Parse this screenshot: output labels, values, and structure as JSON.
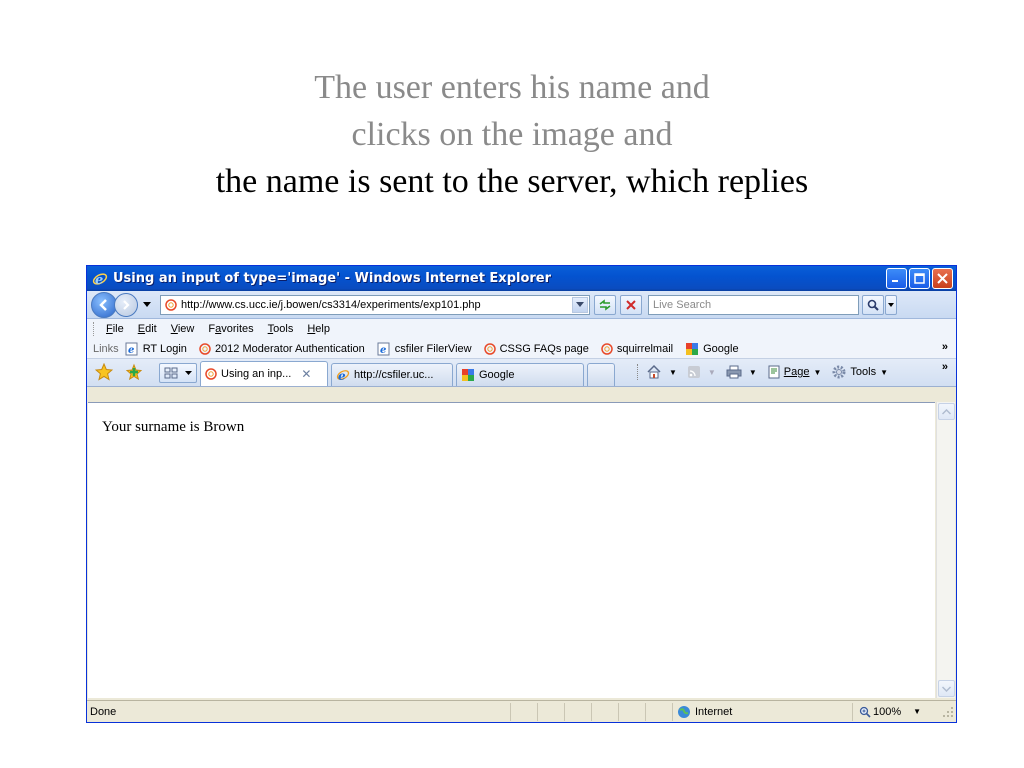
{
  "slide": {
    "line1": "The user enters his name and",
    "line2": "clicks on the image and",
    "line3": "the name is sent to the server, which replies"
  },
  "window": {
    "title": "Using an input of type='image' - Windows Internet Explorer"
  },
  "address": {
    "url": "http://www.cs.ucc.ie/j.bowen/cs3314/experiments/exp101.php",
    "search_placeholder": "Live Search"
  },
  "menu": {
    "items": [
      {
        "label": "File",
        "key": "F",
        "rest": "ile"
      },
      {
        "label": "Edit",
        "key": "E",
        "rest": "dit"
      },
      {
        "label": "View",
        "key": "V",
        "rest": "iew"
      },
      {
        "label": "Favorites",
        "key": "a",
        "pre": "F",
        "rest": "vorites"
      },
      {
        "label": "Tools",
        "key": "T",
        "rest": "ools"
      },
      {
        "label": "Help",
        "key": "H",
        "rest": "elp"
      }
    ]
  },
  "links": {
    "label": "Links",
    "items": [
      {
        "label": "RT Login",
        "icon": "ie-page-icon"
      },
      {
        "label": "2012 Moderator Authentication",
        "icon": "opera-icon"
      },
      {
        "label": "csfiler FilerView",
        "icon": "ie-page-icon"
      },
      {
        "label": "CSSG FAQs page",
        "icon": "opera-icon"
      },
      {
        "label": "squirrelmail",
        "icon": "opera-icon"
      },
      {
        "label": "Google",
        "icon": "google-icon"
      }
    ],
    "chevron": "»"
  },
  "tabs": {
    "items": [
      {
        "label": "Using an inp...",
        "active": true
      },
      {
        "label": "http://csfiler.uc...",
        "active": false
      },
      {
        "label": "Google",
        "active": false
      }
    ],
    "close_glyph": "✕",
    "chevron": "»"
  },
  "commands": {
    "page_label": "Page",
    "tools_label": "Tools"
  },
  "content": {
    "text": "Your surname is Brown"
  },
  "status": {
    "text": "Done",
    "zone": "Internet",
    "zoom": "100%"
  },
  "colors": {
    "titlebar": "#0453d0",
    "slide_grey": "#8a8a8a",
    "chrome": "#ece9d8"
  }
}
